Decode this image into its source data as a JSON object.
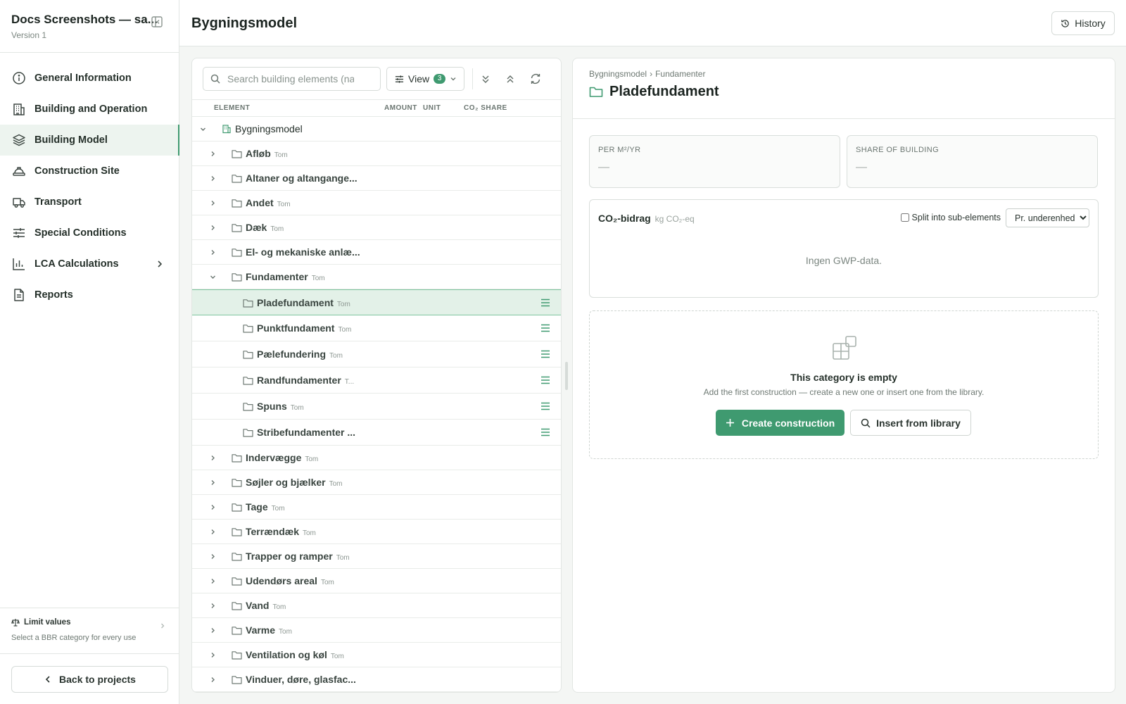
{
  "sidebar": {
    "project_title": "Docs Screenshots — sa...",
    "version": "Version 1",
    "items": [
      {
        "label": "General Information",
        "icon": "info-icon"
      },
      {
        "label": "Building and Operation",
        "icon": "building-icon"
      },
      {
        "label": "Building Model",
        "icon": "layers-icon",
        "active": true
      },
      {
        "label": "Construction Site",
        "icon": "hard-hat-icon"
      },
      {
        "label": "Transport",
        "icon": "truck-icon"
      },
      {
        "label": "Special Conditions",
        "icon": "sliders-icon"
      },
      {
        "label": "LCA Calculations",
        "icon": "bar-chart-icon",
        "has_children": true
      },
      {
        "label": "Reports",
        "icon": "document-icon"
      }
    ],
    "limit_values": {
      "title": "Limit values",
      "subtitle": "Select a BBR category for every use"
    },
    "back_label": "Back to projects"
  },
  "header": {
    "title": "Bygningsmodel",
    "history_label": "History"
  },
  "tree": {
    "search_placeholder": "Search building elements (na",
    "view_label": "View",
    "view_count": "3",
    "columns": {
      "element": "ELEMENT",
      "amount": "AMOUNT",
      "unit": "UNIT",
      "co2_share": "CO₂ SHARE"
    },
    "root": {
      "label": "Bygningsmodel"
    },
    "groups_before": [
      {
        "label": "Afløb",
        "tag": "Tom"
      },
      {
        "label": "Altaner og altangange...",
        "tag": ""
      },
      {
        "label": "Andet",
        "tag": "Tom"
      },
      {
        "label": "Dæk",
        "tag": "Tom"
      },
      {
        "label": "El- og mekaniske anlæ...",
        "tag": ""
      },
      {
        "label": "Fundamenter",
        "tag": "Tom",
        "expanded": true
      }
    ],
    "children": [
      {
        "label": "Pladefundament",
        "tag": "Tom",
        "selected": true
      },
      {
        "label": "Punktfundament",
        "tag": "Tom"
      },
      {
        "label": "Pælefundering",
        "tag": "Tom"
      },
      {
        "label": "Randfundamenter",
        "tag": "T..."
      },
      {
        "label": "Spuns",
        "tag": "Tom"
      },
      {
        "label": "Stribefundamenter ...",
        "tag": ""
      }
    ],
    "groups_after": [
      {
        "label": "Indervægge",
        "tag": "Tom"
      },
      {
        "label": "Søjler og bjælker",
        "tag": "Tom"
      },
      {
        "label": "Tage",
        "tag": "Tom"
      },
      {
        "label": "Terrændæk",
        "tag": "Tom"
      },
      {
        "label": "Trapper og ramper",
        "tag": "Tom"
      },
      {
        "label": "Udendørs areal",
        "tag": "Tom"
      },
      {
        "label": "Vand",
        "tag": "Tom"
      },
      {
        "label": "Varme",
        "tag": "Tom"
      },
      {
        "label": "Ventilation og køl",
        "tag": "Tom"
      },
      {
        "label": "Vinduer, døre, glasfac...",
        "tag": ""
      }
    ]
  },
  "detail": {
    "breadcrumb": [
      "Bygningsmodel",
      "Fundamenter"
    ],
    "breadcrumb_sep": "›",
    "title": "Pladefundament",
    "stats": [
      {
        "label": "PER M²/YR",
        "value": "—"
      },
      {
        "label": "SHARE OF BUILDING",
        "value": "—"
      }
    ],
    "co2": {
      "title": "CO₂-bidrag",
      "unit": "kg CO₂-eq",
      "split_label": "Split into sub-elements",
      "select_value": "Pr. underenhed",
      "empty_text": "Ingen GWP-data."
    },
    "empty": {
      "title": "This category is empty",
      "subtitle": "Add the first construction — create a new one or insert one from the library.",
      "create_label": "Create construction",
      "library_label": "Insert from library"
    }
  },
  "colors": {
    "accent": "#3f9a70",
    "selected_row": "#e3f1e8"
  }
}
